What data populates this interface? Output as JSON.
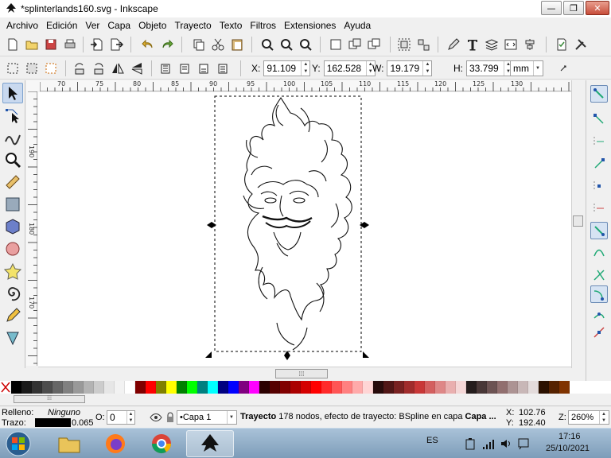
{
  "window": {
    "title": "*splinterlands160.svg - Inkscape",
    "buttons": {
      "minimize": "—",
      "maximize": "❐",
      "close": "✕"
    }
  },
  "menu": [
    "Archivo",
    "Edición",
    "Ver",
    "Capa",
    "Objeto",
    "Trayecto",
    "Texto",
    "Filtros",
    "Extensiones",
    "Ayuda"
  ],
  "selector_toolbar": {
    "x_label": "X:",
    "x_value": "91.109",
    "y_label": "Y:",
    "y_value": "162.528",
    "w_label": "W:",
    "w_value": "19.179",
    "h_label": "H:",
    "h_value": "33.799",
    "unit": "mm"
  },
  "rulers": {
    "top": [
      "70",
      "75",
      "80",
      "85",
      "90",
      "95",
      "100",
      "105",
      "110",
      "115",
      "120",
      "125",
      "130"
    ],
    "left": [
      "190",
      "180",
      "170"
    ]
  },
  "palette": {
    "colors": [
      "#000000",
      "#1a1a1a",
      "#333333",
      "#4d4d4d",
      "#666666",
      "#808080",
      "#999999",
      "#b3b3b3",
      "#cccccc",
      "#e6e6e6",
      "#f2f2f2",
      "#ffffff",
      "#800000",
      "#ff0000",
      "#808000",
      "#ffff00",
      "#008000",
      "#00ff00",
      "#008080",
      "#00ffff",
      "#000080",
      "#0000ff",
      "#800080",
      "#ff00ff",
      "#2b0000",
      "#550000",
      "#800000",
      "#aa0000",
      "#d40000",
      "#ff0000",
      "#ff2a2a",
      "#ff5555",
      "#ff8080",
      "#ffaaaa",
      "#ffd5d5",
      "#280b0b",
      "#501616",
      "#782121",
      "#a02c2c",
      "#c83737",
      "#d35f5f",
      "#de8787",
      "#e9afaf",
      "#f4d7d7",
      "#241c1c",
      "#483737",
      "#6c5353",
      "#916f6f",
      "#ac9393",
      "#c8b7b7",
      "#e3dbdb",
      "#2b1100",
      "#552200",
      "#803300"
    ]
  },
  "status": {
    "fill_label": "Relleno:",
    "fill_value": "Ninguno",
    "stroke_label": "Trazo:",
    "stroke_width": "0.065",
    "opacity_label": "O:",
    "opacity_value": "0",
    "layer": "•Capa 1",
    "message_bold": "Trayecto",
    "message": " 178 nodos, efecto de trayecto: BSpline en capa ",
    "message_layer": "Capa ...",
    "cursor_x_label": "X:",
    "cursor_x": "102.76",
    "cursor_y_label": "Y:",
    "cursor_y": "192.40",
    "zoom_label": "Z:",
    "zoom": "260%"
  },
  "taskbar": {
    "lang": "ES",
    "time": "17:16",
    "date": "25/10/2021"
  },
  "colors": {
    "selection_dashes": "#000000",
    "active_tool": "#c9d9ef"
  }
}
